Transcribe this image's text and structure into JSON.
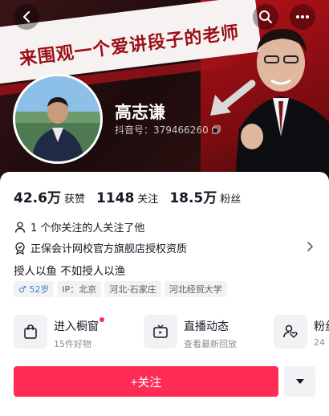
{
  "banner": {
    "slogan": "来围观一个爱讲段子的老师"
  },
  "profile": {
    "name": "高志谦",
    "douyin_id": "抖音号：379466260"
  },
  "stats": [
    {
      "value": "42.6万",
      "label": "获赞"
    },
    {
      "value": "1148",
      "label": "关注"
    },
    {
      "value": "18.5万",
      "label": "粉丝"
    }
  ],
  "info": {
    "mutual_follow": "1 个你关注的人关注了他",
    "certification": "正保会计网校官方旗舰店授权资质",
    "bio": "授人以鱼 不如授人以渔"
  },
  "tags": [
    "♂ 52岁",
    "IP：北京",
    "河北·石家庄",
    "河北经贸大学"
  ],
  "entries": [
    {
      "title": "进入橱窗",
      "subtitle": "15件好物",
      "icon": "shopping-bag-icon",
      "has_dot": true
    },
    {
      "title": "直播动态",
      "subtitle": "查看最新回放",
      "icon": "tv-icon",
      "has_dot": false
    },
    {
      "title": "粉丝",
      "subtitle": "24",
      "icon": "fans-heart-icon",
      "has_dot": false
    }
  ],
  "actions": {
    "follow_label": "+关注"
  },
  "colors": {
    "accent": "#fe2c55",
    "banner_red": "#9b0e15"
  }
}
